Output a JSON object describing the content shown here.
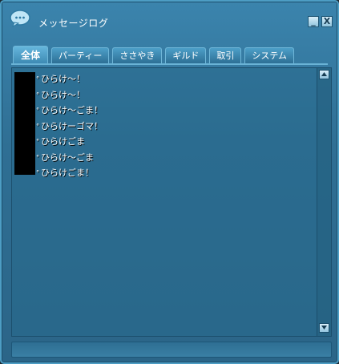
{
  "window": {
    "title": "メッセージログ",
    "minimize_label": "_",
    "close_label": "X"
  },
  "tabs": [
    {
      "label": "全体",
      "active": true
    },
    {
      "label": "パーティー",
      "active": false
    },
    {
      "label": "ささやき",
      "active": false
    },
    {
      "label": "ギルド",
      "active": false
    },
    {
      "label": "取引",
      "active": false
    },
    {
      "label": "システム",
      "active": false
    }
  ],
  "log": {
    "bullet": "°",
    "messages": [
      "ひらけ～！",
      "ひらけ～！",
      "ひらけ～ごま！",
      "ひらけーゴマ！",
      "ひらけごま",
      "ひらけ～ごま",
      "ひらけごま！"
    ]
  },
  "icons": {
    "app": "speech-bubble-icon",
    "scroll_up": "arrow-up-icon",
    "scroll_down": "arrow-down-icon"
  },
  "colors": {
    "window_bg": "#2f6f94",
    "border": "#4d9dc4",
    "text": "#ffffff"
  }
}
